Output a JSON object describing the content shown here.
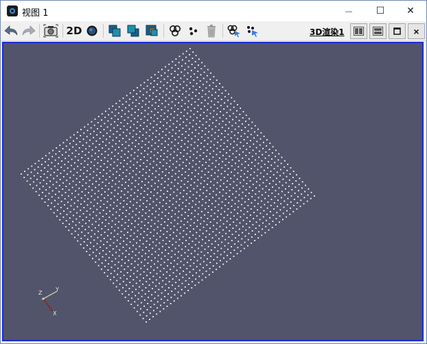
{
  "window": {
    "title": "视图 1",
    "minimize_glyph": "—",
    "maximize_glyph": "☐",
    "close_glyph": "✕"
  },
  "toolbar": {
    "mode_2d_label": "2D",
    "render_link": "3D渲染1",
    "panel_close_glyph": "×",
    "icons": [
      "undo-view-icon",
      "redo-view-icon",
      "screenshot-icon",
      "2d-mode",
      "sphere-icon",
      "layer-front-icon",
      "layer-back-icon",
      "layer-middle-icon",
      "select-cells-icon",
      "select-points-icon",
      "delete-icon",
      "interactive-select-cells-icon",
      "interactive-select-points-icon"
    ]
  },
  "viewport": {
    "background": "#51546a",
    "point_color": "#ffffff",
    "axes": {
      "x": "X",
      "y": "Y",
      "z": "Z"
    }
  },
  "colors": {
    "accent_border": "#1b2bd8",
    "teal": "#1e8fb0",
    "dark_teal": "#1a5f8a"
  }
}
